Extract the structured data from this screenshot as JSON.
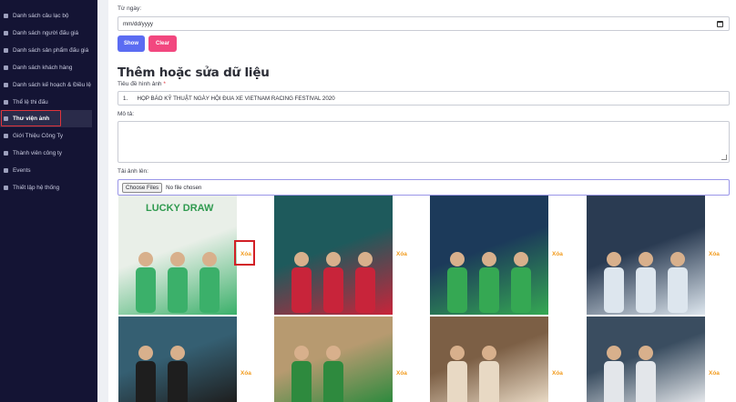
{
  "sidebar": {
    "items": [
      {
        "label": "Danh sách câu lạc bộ",
        "icon": "trophy-icon"
      },
      {
        "label": "Danh sách người đấu giá",
        "icon": "gavel-icon"
      },
      {
        "label": "Danh sách sản phẩm đấu giá",
        "icon": "bar-chart-icon"
      },
      {
        "label": "Danh sách khách hàng",
        "icon": "user-circle-icon"
      },
      {
        "label": "Danh sách kế hoạch & Điều lệ",
        "icon": "book-icon"
      },
      {
        "label": "Thể lệ thi đấu",
        "icon": "document-icon"
      },
      {
        "label": "Thư viện ảnh",
        "icon": "image-icon"
      },
      {
        "label": "Giới Thiệu Công Ty",
        "icon": "globe-icon"
      },
      {
        "label": "Thành viên công ty",
        "icon": "users-icon"
      },
      {
        "label": "Events",
        "icon": "calendar-icon"
      },
      {
        "label": "Thiết lập hệ thống",
        "icon": "gear-icon"
      }
    ],
    "active_index": 6
  },
  "filter": {
    "date_label": "Từ ngày:",
    "date_placeholder": "mm/dd/yyyy",
    "show_label": "Show",
    "clear_label": "Clear"
  },
  "form": {
    "title": "Thêm hoặc sửa dữ liệu",
    "image_title_label": "Tiêu đề hình ảnh",
    "required_mark": "*",
    "image_title_value": "1.      HỌP BÁO KỸ THUẬT NGÀY HỘI ĐUA XE VIETNAM RACING FESTIVAL 2020",
    "description_label": "Mô tả:",
    "upload_label": "Tải ảnh lên:",
    "choose_files_label": "Choose Files",
    "no_file_text": "No file chosen"
  },
  "gallery": {
    "delete_label": "Xóa",
    "photos": [
      {
        "name": "lucky-draw-photo",
        "text": "LUCKY DRAW",
        "bg": "#e9efe8",
        "accent": "#3bb06a"
      },
      {
        "name": "sponsors-group-photo",
        "text": "",
        "bg": "#1e5a5c",
        "accent": "#c8243a"
      },
      {
        "name": "press-conference-panel-photo",
        "text": "",
        "bg": "#1c3a5a",
        "accent": "#35a853"
      },
      {
        "name": "presentation-screen-photo",
        "text": "",
        "bg": "#2a3b52",
        "accent": "#dde6ee"
      },
      {
        "name": "woman-speaker-photo",
        "text": "",
        "bg": "#355f72",
        "accent": "#1e1e1e"
      },
      {
        "name": "team-group-photo",
        "text": "",
        "bg": "#b79a70",
        "accent": "#2e8a3e"
      },
      {
        "name": "speaker-microphone-photo",
        "text": "",
        "bg": "#7c5f45",
        "accent": "#e8d9c4"
      },
      {
        "name": "audience-room-photo",
        "text": "",
        "bg": "#3a4d60",
        "accent": "#e3e6ea"
      }
    ]
  }
}
